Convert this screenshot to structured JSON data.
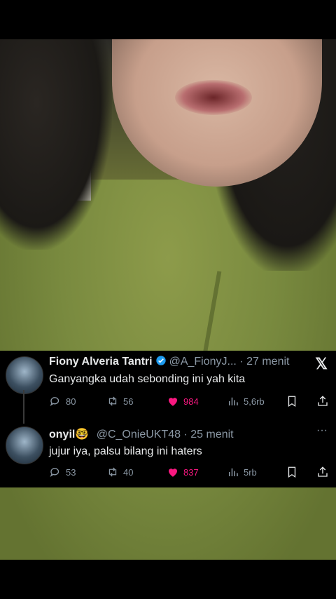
{
  "tweets": [
    {
      "name": "Fiony Alveria Tantri",
      "handle": "@A_FionyJ...",
      "time": "· 27 menit",
      "text": "Ganyangka udah sebonding ini yah kita",
      "replies": "80",
      "retweets": "56",
      "likes": "984",
      "views": "5,6rb"
    },
    {
      "name": "onyil🤓",
      "handle": "@C_OnieUKT48",
      "time": "· 25 menit",
      "text": "jujur iya, palsu bilang ini haters",
      "replies": "53",
      "retweets": "40",
      "likes": "837",
      "views": "5rb"
    }
  ],
  "colors": {
    "like": "#f91880",
    "verified": "#1d9bf0",
    "muted": "#8b98a5"
  },
  "icons": [
    "x-logo",
    "verified-badge",
    "reply-icon",
    "retweet-icon",
    "heart-icon",
    "views-icon",
    "bookmark-icon",
    "share-icon",
    "more-icon"
  ]
}
